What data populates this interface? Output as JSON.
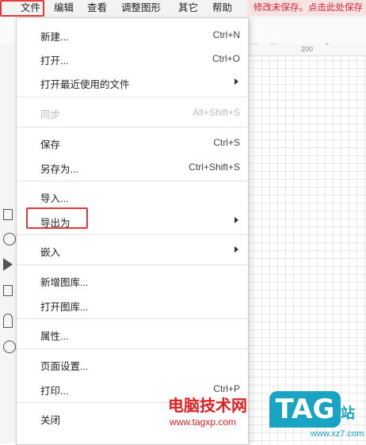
{
  "menubar": {
    "items": [
      "文件",
      "编辑",
      "查看",
      "调整图形",
      "其它",
      "帮助"
    ],
    "unsaved_notice": "修改未保存。点击此处保存"
  },
  "ruler": {
    "mark": "200"
  },
  "file_menu": {
    "items": [
      {
        "label": "新建...",
        "shortcut": "Ctrl+N"
      },
      {
        "label": "打开...",
        "shortcut": "Ctrl+O"
      },
      {
        "label": "打开最近使用的文件",
        "submenu": true
      },
      {
        "label": "同步",
        "shortcut": "Alt+Shift+S",
        "disabled": true
      },
      {
        "label": "保存",
        "shortcut": "Ctrl+S"
      },
      {
        "label": "另存为...",
        "shortcut": "Ctrl+Shift+S"
      },
      {
        "label": "导入..."
      },
      {
        "label": "导出为",
        "submenu": true,
        "highlighted": true
      },
      {
        "label": "嵌入",
        "submenu": true
      },
      {
        "label": "新增图库..."
      },
      {
        "label": "打开图库..."
      },
      {
        "label": "属性..."
      },
      {
        "label": "页面设置..."
      },
      {
        "label": "打印...",
        "shortcut": "Ctrl+P"
      },
      {
        "label": "关闭"
      }
    ]
  },
  "watermark": {
    "site_name": "电脑技术网",
    "site_url": "www.tagxp.com",
    "logo_text": "TAG",
    "logo_suffix": "站",
    "second_url": "www.xz7.com"
  },
  "colors": {
    "highlight_red": "#e53935",
    "tag_blue": "#1aa4c4",
    "watermark_red": "#e02020"
  }
}
